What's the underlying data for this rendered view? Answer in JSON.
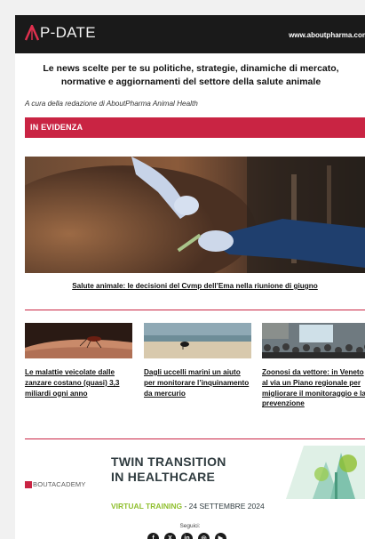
{
  "header": {
    "logo_text": "P-DATE",
    "site_url": "www.aboutpharma.com"
  },
  "intro": {
    "text": "Le news scelte per te su politiche, strategie, dinamiche di mercato, normative e aggiornamenti del settore della salute animale",
    "byline": "A cura della redazione di AboutPharma Animal Health"
  },
  "section": {
    "title": "IN EVIDENZA"
  },
  "hero": {
    "image": "veterinarian-injecting-cow-photo",
    "caption": "Salute animale: le decisioni del Cvmp dell’Ema nella riunione di giugno"
  },
  "cards": [
    {
      "image": "mosquito-on-skin-photo",
      "title": "Le malattie veicolate dalle zanzare costano (quasi) 3,3 miliardi ogni anno"
    },
    {
      "image": "seabird-on-beach-photo",
      "title": "Dagli uccelli marini un aiuto per monitorare l’inquinamento da mercurio"
    },
    {
      "image": "conference-audience-photo",
      "title": "Zoonosi da vettore: in Veneto al via un Piano regionale per migliorare il monitoraggio e la prevenzione"
    }
  ],
  "banner": {
    "academy_label": "BOUTACADEMY",
    "headline_1": "TWIN TRANSITION",
    "headline_2": "IN HEALTHCARE",
    "event_type": "VIRTUAL TRAINING",
    "event_date": " - 24 SETTEMBRE 2024",
    "art": "green-building-illustration"
  },
  "footer": {
    "follow_label": "Seguici:",
    "social": [
      {
        "icon": "facebook-icon",
        "glyph": "f"
      },
      {
        "icon": "x-icon",
        "glyph": "X"
      },
      {
        "icon": "linkedin-icon",
        "glyph": "in"
      },
      {
        "icon": "instagram-icon",
        "glyph": "◎"
      },
      {
        "icon": "youtube-icon",
        "glyph": "▶"
      }
    ]
  },
  "colors": {
    "accent": "#c92443",
    "header_bg": "#1a1a1a",
    "banner_green": "#8fbf2e"
  }
}
